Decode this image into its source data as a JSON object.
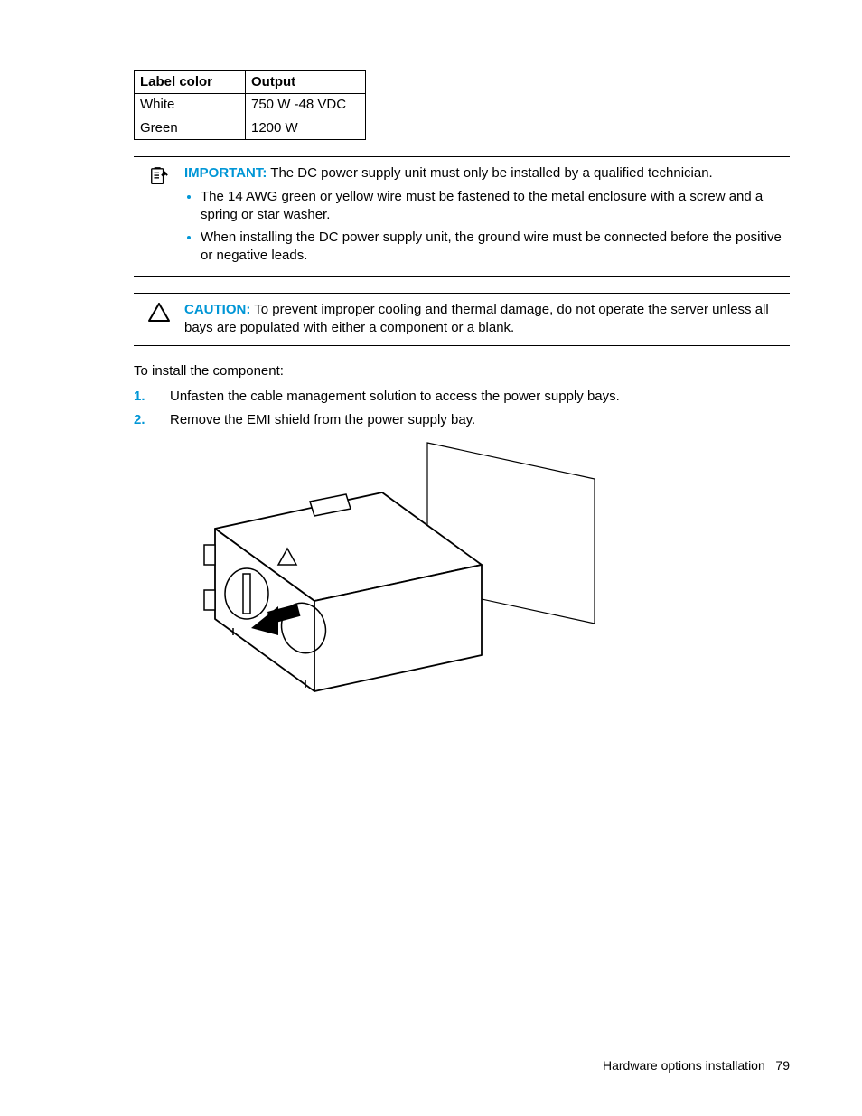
{
  "table": {
    "headers": [
      "Label color",
      "Output"
    ],
    "rows": [
      [
        "White",
        "750 W -48 VDC"
      ],
      [
        "Green",
        "1200 W"
      ]
    ]
  },
  "important_box": {
    "label": "IMPORTANT:",
    "lead": " The DC power supply unit must only be installed by a qualified technician.",
    "bullets": [
      "The 14 AWG green or yellow wire must be fastened to the metal enclosure with a screw and a spring or star washer.",
      "When installing the DC power supply unit, the ground wire must be connected before the positive or negative leads."
    ]
  },
  "caution_box": {
    "label": "CAUTION:",
    "text": "   To prevent improper cooling and thermal damage, do not operate the server unless all bays are populated with either a component or a blank."
  },
  "intro": "To install the component:",
  "steps": [
    "Unfasten the cable management solution to access the power supply bays.",
    "Remove the EMI shield from the power supply bay."
  ],
  "footer": {
    "section": "Hardware options installation",
    "page": "79"
  }
}
